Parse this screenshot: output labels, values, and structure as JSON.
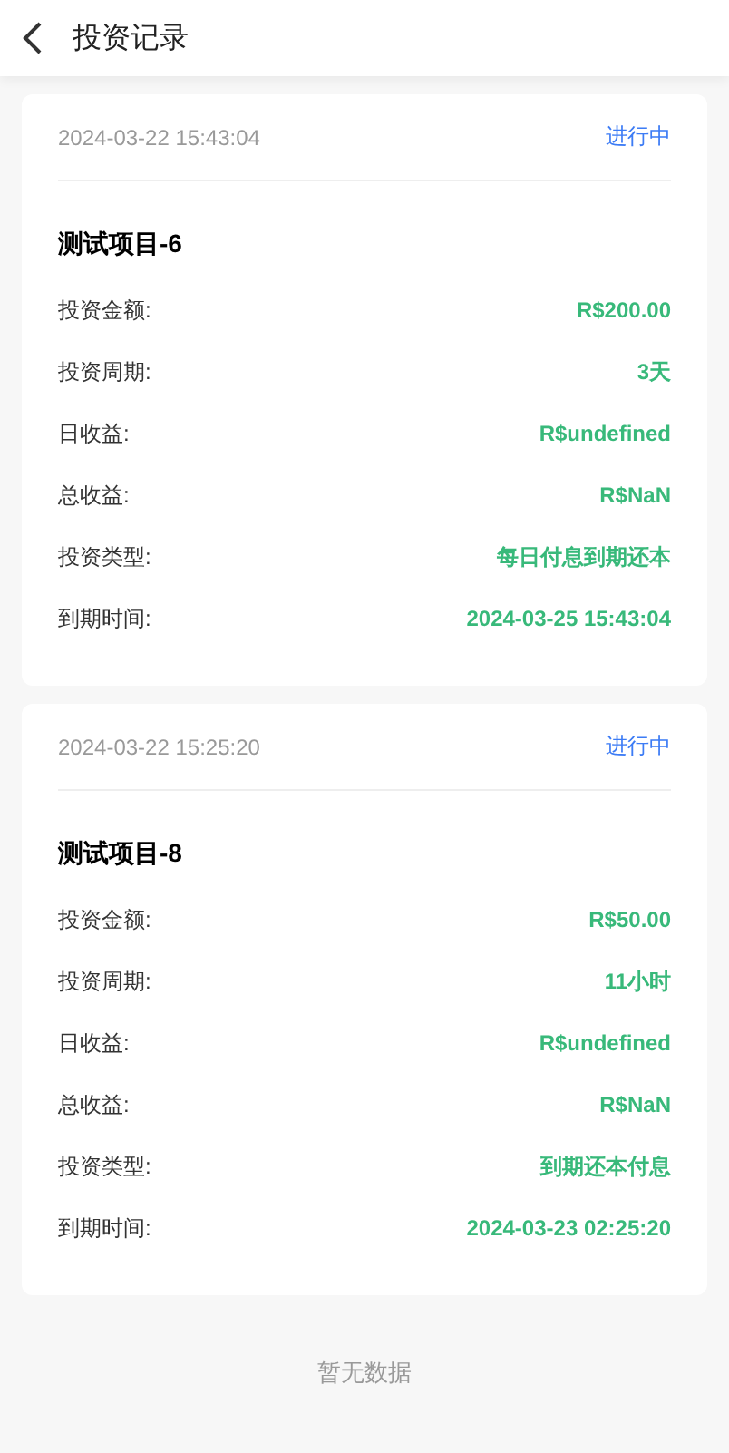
{
  "header": {
    "title": "投资记录"
  },
  "records": [
    {
      "date": "2024-03-22 15:43:04",
      "status": "进行中",
      "project": "测试项目-6",
      "fields": [
        {
          "label": "投资金额:",
          "value": "R$200.00"
        },
        {
          "label": "投资周期:",
          "value": "3天"
        },
        {
          "label": "日收益:",
          "value": "R$undefined"
        },
        {
          "label": "总收益:",
          "value": "R$NaN"
        },
        {
          "label": "投资类型:",
          "value": "每日付息到期还本"
        },
        {
          "label": "到期时间:",
          "value": "2024-03-25 15:43:04"
        }
      ]
    },
    {
      "date": "2024-03-22 15:25:20",
      "status": "进行中",
      "project": "测试项目-8",
      "fields": [
        {
          "label": "投资金额:",
          "value": "R$50.00"
        },
        {
          "label": "投资周期:",
          "value": "11小时"
        },
        {
          "label": "日收益:",
          "value": "R$undefined"
        },
        {
          "label": "总收益:",
          "value": "R$NaN"
        },
        {
          "label": "投资类型:",
          "value": "到期还本付息"
        },
        {
          "label": "到期时间:",
          "value": "2024-03-23 02:25:20"
        }
      ]
    }
  ],
  "empty_text": "暂无数据"
}
